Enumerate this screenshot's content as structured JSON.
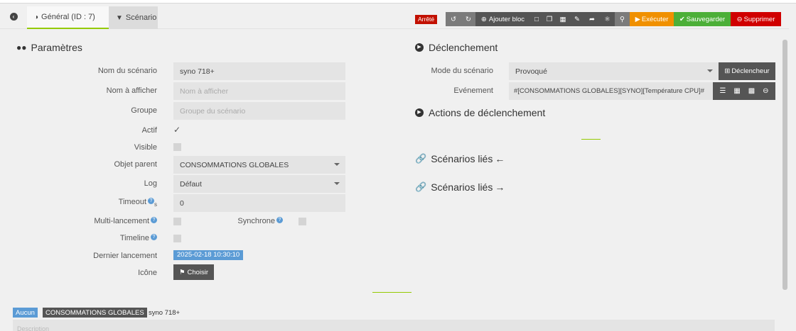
{
  "tabs": {
    "general": "Général (ID : 7)",
    "scenario": "Scénario"
  },
  "toolbar": {
    "status": "Arrêté",
    "add_block": "Ajouter bloc",
    "execute": "Exécuter",
    "save": "Sauvegarder",
    "delete": "Supprimer"
  },
  "params": {
    "title": "Paramètres",
    "name_label": "Nom du scénario",
    "name_value": "syno 718+",
    "display_label": "Nom à afficher",
    "display_placeholder": "Nom à afficher",
    "group_label": "Groupe",
    "group_placeholder": "Groupe du scénario",
    "active_label": "Actif",
    "visible_label": "Visible",
    "parent_label": "Objet parent",
    "parent_value": "CONSOMMATIONS GLOBALES",
    "log_label": "Log",
    "log_value": "Défaut",
    "timeout_label": "Timeout",
    "timeout_unit": "s",
    "timeout_value": "0",
    "multi_label": "Multi-lancement",
    "sync_label": "Synchrone",
    "timeline_label": "Timeline",
    "last_run_label": "Dernier lancement",
    "last_run_value": "2025-02-18 10:30:10",
    "icon_label": "Icône",
    "choose_button": "Choisir"
  },
  "trigger": {
    "title": "Déclenchement",
    "mode_label": "Mode du scénario",
    "mode_value": "Provoqué",
    "trigger_button": "Déclencheur",
    "event_label": "Evénement",
    "event_value": "#[CONSOMMATIONS GLOBALES][SYNO][Température CPU]#"
  },
  "sections": {
    "actions": "Actions de déclenchement",
    "linked_out": "Scénarios liés",
    "linked_in": "Scénarios liés"
  },
  "footer": {
    "tag_none": "Aucun",
    "tag_object": "CONSOMMATIONS GLOBALES",
    "name": "syno 718+",
    "description_placeholder": "Description"
  },
  "colors": {
    "accent": "#94ca02",
    "status_red": "#c21000",
    "execute": "#f09000",
    "save": "#4caf38",
    "delete": "#d00000",
    "last_run": "#5b9bd5"
  }
}
